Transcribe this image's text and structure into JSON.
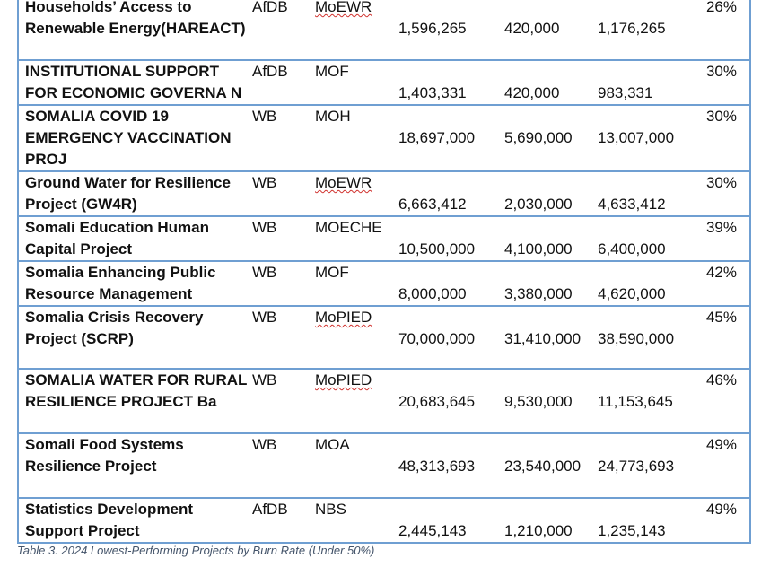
{
  "table": {
    "rows": [
      {
        "name": "Households’ Access to Renewable Energy(HAREACT)",
        "funder": "AfDB",
        "entity": "MoEWR",
        "amount": "1,596,265",
        "disbursed": "420,000",
        "balance": "1,176,265",
        "rate": "26%",
        "rowtop": 3,
        "spell": true
      },
      {
        "name": "INSTITUTIONAL SUPPORT FOR ECONOMIC GOVERNA N",
        "funder": "AfDB",
        "entity": "MOF",
        "amount": "1,403,331",
        "disbursed": "420,000",
        "balance": "983,331",
        "rate": "30%",
        "rowtop": 1,
        "spell": false
      },
      {
        "name": "SOMALIA COVID 19 EMERGENCY VACCINATION PROJ",
        "funder": "WB",
        "entity": "MOH",
        "amount": "18,697,000",
        "disbursed": "5,690,000",
        "balance": "13,007,000",
        "rate": "30%",
        "rowtop": 1,
        "spell": false
      },
      {
        "name": " Ground Water for Resilience Project (GW4R)",
        "funder": "WB",
        "entity": "MoEWR",
        "amount": "6,663,412",
        "disbursed": "2,030,000",
        "balance": "4,633,412",
        "rate": "30%",
        "rowtop": 1,
        "spell": true
      },
      {
        "name": " Somali Education Human Capital Project",
        "funder": "WB",
        "entity": "MOECHE",
        "amount": "10,500,000",
        "disbursed": "4,100,000",
        "balance": "6,400,000",
        "rate": "39%",
        "rowtop": 1,
        "spell": false
      },
      {
        "name": " Somalia Enhancing Public Resource Management",
        "funder": "WB",
        "entity": "MOF",
        "amount": "8,000,000",
        "disbursed": "3,380,000",
        "balance": "4,620,000",
        "rate": "42%",
        "rowtop": 1,
        "spell": false
      },
      {
        "name": " Somalia Crisis Recovery Project (SCRP)",
        "funder": "WB",
        "entity": "MoPIED",
        "amount": "70,000,000",
        "disbursed": "31,410,000",
        "balance": "38,590,000",
        "rate": "45%",
        "rowtop": 1,
        "spell": true
      },
      {
        "name": " SOMALIA WATER FOR RURAL RESILIENCE PROJECT Ba",
        "funder": "WB",
        "entity": "MoPIED",
        "amount": "20,683,645",
        "disbursed": "9,530,000",
        "balance": "11,153,645",
        "rate": "46%",
        "rowtop": 1,
        "spell": true
      },
      {
        "name": " Somali Food Systems Resilience Project",
        "funder": "WB",
        "entity": "MOA",
        "amount": "48,313,693",
        "disbursed": "23,540,000",
        "balance": "24,773,693",
        "rate": "49%",
        "rowtop": 1,
        "spell": false
      },
      {
        "name": " Statistics Development Support Project",
        "funder": "AfDB",
        "entity": "NBS",
        "amount": "2,445,143",
        "disbursed": "1,210,000",
        "balance": "1,235,143",
        "rate": "49%",
        "rowtop": 1,
        "spell": false
      }
    ]
  },
  "caption": "Table 3. 2024 Lowest-Performing Projects by Burn Rate (Under 50%)"
}
